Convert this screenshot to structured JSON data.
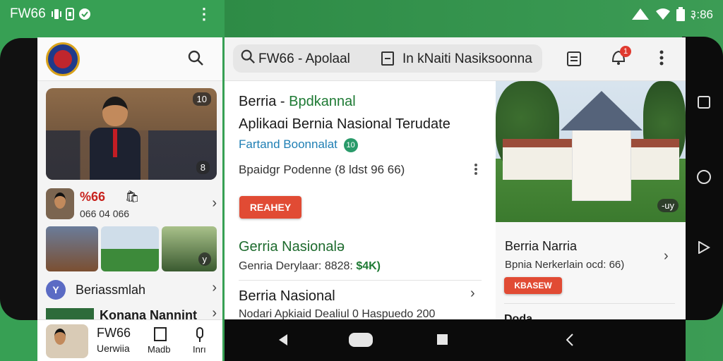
{
  "status_left": {
    "app": "FW66",
    "more": "⋮"
  },
  "status_right": {
    "time": "३:86"
  },
  "left_pane": {
    "hero_badge_top": "10",
    "hero_badge_bottom": "8",
    "item1": {
      "title": "%66",
      "subtitle": "066 04 066"
    },
    "thumb_badge": "y",
    "item2": {
      "label": "Beriassmlah",
      "icon_letter": "Y"
    },
    "item3": {
      "label": "Konana Nannint"
    },
    "bottom": {
      "title": "FW66",
      "caption": "Uerwiia",
      "action1": "Madb",
      "action2": "Inrı"
    }
  },
  "topbar": {
    "search_text": "FW66 - Apolaal",
    "search_text2": "In kNaiti Nasiksoonna",
    "notif_count": "1"
  },
  "article": {
    "kicker_black": "Berria - ",
    "kicker_green": "Bpdkannal",
    "headline": "Aplikaɑi Bernia Nasional Terudate",
    "source": "Fartand Boonnalat",
    "source_badge": "10",
    "meta": "Bpaidgr Podenne (8 ldst 96 66)",
    "button": "REAHEY"
  },
  "list": [
    {
      "title": "Gerria Nasionalə",
      "meta_black": "Genria Derylaar: 8828: ",
      "meta_green": "$4K)"
    },
    {
      "title": "Berria Nasional",
      "meta": "Nodari Apkiaid Dealiul 0 Haspuedo 200"
    }
  ],
  "right_pane": {
    "image_badge": "-uy",
    "card_title": "Berria Narria",
    "card_meta": "Bpnia Nerkerlain ocd: 66)",
    "card_button": "KBASEW",
    "card2_title": "Doda"
  },
  "colors": {
    "brand_green": "#2e8b46",
    "accent_red": "#e14b34",
    "link_green": "#1e7a34",
    "source_blue": "#1f7fb4"
  },
  "icons": [
    "search-icon",
    "box-icon",
    "clipboard-icon",
    "bell-icon",
    "more-icon",
    "chevron-right-icon",
    "back-icon",
    "home-icon",
    "recents-icon"
  ]
}
